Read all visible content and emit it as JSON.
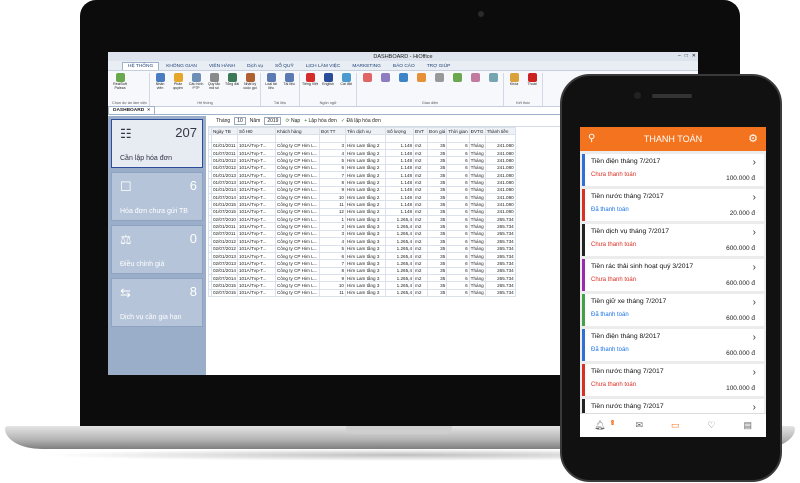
{
  "desktop": {
    "window_title": "DASHBOARD - HiOffice",
    "menu_tabs": [
      "HỆ THỐNG",
      "KHÔNG GIAN",
      "VIÊN HÀNH",
      "Dịch vụ",
      "SỔ QUỸ",
      "LỊCH LÀM VIỆC",
      "MARKETING",
      "BÁO CÁO",
      "TRỢ GIÚP"
    ],
    "ribbon": {
      "groups": [
        {
          "label": "Chọn dự án làm việc",
          "items": [
            {
              "label": "RealSoft Paleza",
              "color": "#6aa84f"
            }
          ]
        },
        {
          "label": "Hệ thống",
          "items": [
            {
              "label": "Nhân viên",
              "color": "#4a7cc2"
            },
            {
              "label": "Phân quyền",
              "color": "#e5a629"
            },
            {
              "label": "Cấu hình PTP",
              "color": "#6d8fb5"
            },
            {
              "label": "Quy tắc mã số",
              "color": "#8a8a8a"
            },
            {
              "label": "Tổng đài",
              "color": "#3b7a57"
            },
            {
              "label": "Nhật ký cuộc gọi",
              "color": "#b06030"
            }
          ]
        },
        {
          "label": "Tài liệu",
          "items": [
            {
              "label": "Loại tài liệu",
              "color": "#5b79b3"
            },
            {
              "label": "Tài liệu",
              "color": "#5b79b3"
            }
          ]
        },
        {
          "label": "Ngôn ngữ",
          "items": [
            {
              "label": "Tiếng Việt",
              "color": "#d62b2b"
            },
            {
              "label": "English",
              "color": "#2a4d9b"
            },
            {
              "label": "Cài đặt",
              "color": "#4b9bd1"
            }
          ]
        },
        {
          "label": "Giao diện",
          "items": [
            {
              "label": "",
              "color": "#e06666"
            },
            {
              "label": "",
              "color": "#8e7cc3"
            },
            {
              "label": "",
              "color": "#3d85c6"
            },
            {
              "label": "",
              "color": "#e69138"
            },
            {
              "label": "",
              "color": "#999999"
            },
            {
              "label": "",
              "color": "#6aa84f"
            },
            {
              "label": "",
              "color": "#c27ba0"
            },
            {
              "label": "",
              "color": "#76a5af"
            }
          ]
        },
        {
          "label": "Kết thúc",
          "items": [
            {
              "label": "Khóa",
              "color": "#d9a23a"
            },
            {
              "label": "Thoát",
              "color": "#cc2222"
            }
          ]
        }
      ]
    },
    "doc_tab": "DASHBOARD",
    "tiles": [
      {
        "count": "207",
        "label": "Cần lập hóa đơn",
        "icon": "☷"
      },
      {
        "count": "6",
        "label": "Hóa đơn chưa gửi TB",
        "icon": "☐"
      },
      {
        "count": "0",
        "label": "Điều chỉnh giá",
        "icon": "⚖"
      },
      {
        "count": "8",
        "label": "Dịch vụ cần gia hạn",
        "icon": "⇆"
      }
    ],
    "controls": {
      "month_label": "Tháng",
      "month": "10",
      "year_label": "Năm",
      "year": "2019",
      "load": "Nạp",
      "create": "Lập hóa đơn",
      "created": "Đã lập hóa đơn"
    },
    "table": {
      "headers": [
        "Ngày TB",
        "Số HĐ",
        "Khách hàng",
        "Đợt TT",
        "Tên dịch vụ",
        "Số lượng",
        "ĐVT",
        "Đơn giá",
        "Thời gian",
        "ĐVTG",
        "Thành tiền"
      ],
      "rows": [
        [
          "01/01/2011",
          "101A/Tvp-T...",
          "Công ty CP Him L...",
          "3",
          "Him Lam tầng 2",
          "1.148",
          "m2",
          "35",
          "6",
          "Tháng",
          "241.080"
        ],
        [
          "01/07/2011",
          "101A/Tvp-T...",
          "Công ty CP Him L...",
          "4",
          "Him Lam tầng 2",
          "1.148",
          "m2",
          "35",
          "6",
          "Tháng",
          "241.080"
        ],
        [
          "01/01/2012",
          "101A/Tvp-T...",
          "Công ty CP Him L...",
          "5",
          "Him Lam tầng 2",
          "1.148",
          "m2",
          "35",
          "6",
          "Tháng",
          "241.080"
        ],
        [
          "01/07/2012",
          "101A/Tvp-T...",
          "Công ty CP Him L...",
          "6",
          "Him Lam tầng 2",
          "1.148",
          "m2",
          "35",
          "6",
          "Tháng",
          "241.080"
        ],
        [
          "01/01/2013",
          "101A/Tvp-T...",
          "Công ty CP Him L...",
          "7",
          "Him Lam tầng 2",
          "1.148",
          "m2",
          "35",
          "6",
          "Tháng",
          "241.080"
        ],
        [
          "01/07/2013",
          "101A/Tvp-T...",
          "Công ty CP Him L...",
          "8",
          "Him Lam tầng 2",
          "1.148",
          "m2",
          "35",
          "6",
          "Tháng",
          "241.080"
        ],
        [
          "01/01/2014",
          "101A/Tvp-T...",
          "Công ty CP Him L...",
          "9",
          "Him Lam tầng 2",
          "1.148",
          "m2",
          "35",
          "6",
          "Tháng",
          "241.080"
        ],
        [
          "01/07/2014",
          "101A/Tvp-T...",
          "Công ty CP Him L...",
          "10",
          "Him Lam tầng 2",
          "1.148",
          "m2",
          "35",
          "6",
          "Tháng",
          "241.080"
        ],
        [
          "01/01/2015",
          "101A/Tvp-T...",
          "Công ty CP Him L...",
          "11",
          "Him Lam tầng 2",
          "1.148",
          "m2",
          "35",
          "6",
          "Tháng",
          "241.080"
        ],
        [
          "01/07/2015",
          "101A/Tvp-T...",
          "Công ty CP Him L...",
          "12",
          "Him Lam tầng 2",
          "1.148",
          "m2",
          "35",
          "6",
          "Tháng",
          "241.080"
        ],
        [
          "02/07/2010",
          "101A/Tvp-T...",
          "Công ty CP Him L...",
          "1",
          "Him Lam tầng 3",
          "1.265,4",
          "m2",
          "35",
          "6",
          "Tháng",
          "265.734"
        ],
        [
          "02/01/2011",
          "101A/Tvp-T...",
          "Công ty CP Him L...",
          "2",
          "Him Lam tầng 3",
          "1.265,4",
          "m2",
          "35",
          "6",
          "Tháng",
          "265.734"
        ],
        [
          "02/07/2011",
          "101A/Tvp-T...",
          "Công ty CP Him L...",
          "3",
          "Him Lam tầng 3",
          "1.265,4",
          "m2",
          "35",
          "6",
          "Tháng",
          "265.734"
        ],
        [
          "02/01/2012",
          "101A/Tvp-T...",
          "Công ty CP Him L...",
          "4",
          "Him Lam tầng 3",
          "1.265,4",
          "m2",
          "35",
          "6",
          "Tháng",
          "265.734"
        ],
        [
          "02/07/2012",
          "101A/Tvp-T...",
          "Công ty CP Him L...",
          "5",
          "Him Lam tầng 3",
          "1.265,4",
          "m2",
          "35",
          "6",
          "Tháng",
          "265.734"
        ],
        [
          "02/01/2013",
          "101A/Tvp-T...",
          "Công ty CP Him L...",
          "6",
          "Him Lam tầng 3",
          "1.265,4",
          "m2",
          "35",
          "6",
          "Tháng",
          "265.734"
        ],
        [
          "02/07/2013",
          "101A/Tvp-T...",
          "Công ty CP Him L...",
          "7",
          "Him Lam tầng 3",
          "1.265,4",
          "m2",
          "35",
          "6",
          "Tháng",
          "265.734"
        ],
        [
          "02/01/2014",
          "101A/Tvp-T...",
          "Công ty CP Him L...",
          "8",
          "Him Lam tầng 3",
          "1.265,4",
          "m2",
          "35",
          "6",
          "Tháng",
          "265.734"
        ],
        [
          "02/07/2014",
          "101A/Tvp-T...",
          "Công ty CP Him L...",
          "9",
          "Him Lam tầng 3",
          "1.265,4",
          "m2",
          "35",
          "6",
          "Tháng",
          "265.734"
        ],
        [
          "02/01/2015",
          "101A/Tvp-T...",
          "Công ty CP Him L...",
          "10",
          "Him Lam tầng 3",
          "1.265,4",
          "m2",
          "35",
          "6",
          "Tháng",
          "265.734"
        ],
        [
          "02/07/2015",
          "101A/Tvp-T...",
          "Công ty CP Him L...",
          "11",
          "Him Lam tầng 3",
          "1.265,4",
          "m2",
          "35",
          "6",
          "Tháng",
          "265.734"
        ]
      ]
    }
  },
  "phone": {
    "title": "THANH TOÁN",
    "accent": "#f4731f",
    "notif_count": "0",
    "items": [
      {
        "title": "Tiền điện tháng 7/2017",
        "status": "Chưa thanh toán",
        "status_color": "#d93025",
        "amount": "100.000 đ",
        "bar": "#2f6fd6"
      },
      {
        "title": "Tiền nước tháng 7/2017",
        "status": "Đã thanh toán",
        "status_color": "#1a73e8",
        "amount": "20.000 đ",
        "bar": "#d93025"
      },
      {
        "title": "Tiền dịch vụ tháng 7/2017",
        "status": "Chưa thanh toán",
        "status_color": "#d93025",
        "amount": "600.000 đ",
        "bar": "#222222"
      },
      {
        "title": "Tiền rác thải sinh hoạt quý 3/2017",
        "status": "Chưa thanh toán",
        "status_color": "#d93025",
        "amount": "600.000 đ",
        "bar": "#9c27b0"
      },
      {
        "title": "Tiền giữ xe tháng 7/2017",
        "status": "Đã thanh toán",
        "status_color": "#1a73e8",
        "amount": "600.000 đ",
        "bar": "#43a047"
      },
      {
        "title": "Tiền điện tháng 8/2017",
        "status": "Đã thanh toán",
        "status_color": "#1a73e8",
        "amount": "600.000 đ",
        "bar": "#2f6fd6"
      },
      {
        "title": "Tiền nước tháng 7/2017",
        "status": "Chưa thanh toán",
        "status_color": "#d93025",
        "amount": "100.000 đ",
        "bar": "#d93025"
      },
      {
        "title": "Tiền nước tháng 7/2017",
        "status": "",
        "status_color": "#d93025",
        "amount": "",
        "bar": "#222222"
      }
    ]
  }
}
